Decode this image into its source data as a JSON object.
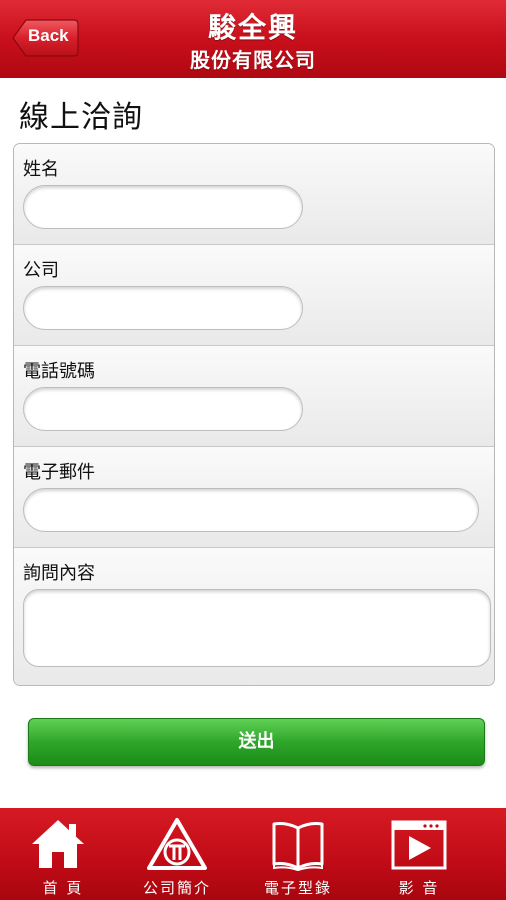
{
  "header": {
    "back_label": "Back",
    "title": "駿全興",
    "subtitle": "股份有限公司"
  },
  "page_title": "線上洽詢",
  "form": {
    "fields": [
      {
        "label": "姓名",
        "value": ""
      },
      {
        "label": "公司",
        "value": ""
      },
      {
        "label": "電話號碼",
        "value": ""
      },
      {
        "label": "電子郵件",
        "value": ""
      },
      {
        "label": "詢問內容",
        "value": ""
      }
    ],
    "submit_label": "送出"
  },
  "tabbar": {
    "items": [
      {
        "label": "首 頁",
        "icon": "home-icon"
      },
      {
        "label": "公司簡介",
        "icon": "company-logo-icon"
      },
      {
        "label": "電子型錄",
        "icon": "book-icon"
      },
      {
        "label": "影 音",
        "icon": "video-play-icon"
      }
    ]
  },
  "colors": {
    "header_red": "#c8101c",
    "submit_green": "#2fa62a",
    "tab_red": "#c00b16"
  }
}
